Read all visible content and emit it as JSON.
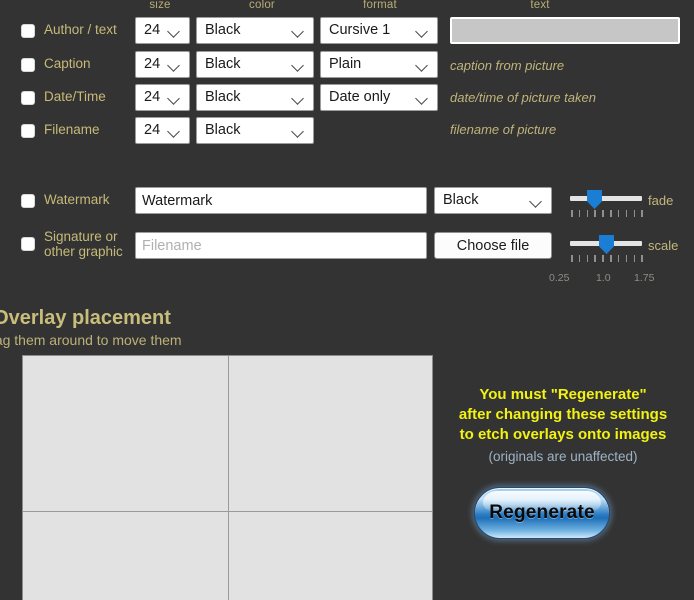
{
  "columns": {
    "size": "size",
    "color": "color",
    "format": "format",
    "text": "text"
  },
  "text_rows": [
    {
      "label": "Author / text",
      "checked": false,
      "size": "24",
      "color": "Black",
      "format": "Cursive 1",
      "text_value": "",
      "text_placeholder": "",
      "hint": ""
    },
    {
      "label": "Caption",
      "checked": false,
      "size": "24",
      "color": "Black",
      "format": "Plain",
      "hint": "caption from picture"
    },
    {
      "label": "Date/Time",
      "checked": false,
      "size": "24",
      "color": "Black",
      "format": "Date only",
      "hint": "date/time of picture taken"
    },
    {
      "label": "Filename",
      "checked": false,
      "size": "24",
      "color": "Black",
      "format": "",
      "hint": "filename of picture"
    }
  ],
  "watermark": {
    "label": "Watermark",
    "checked": false,
    "value": "Watermark",
    "color": "Black",
    "slider_name": "fade",
    "slider_percent": 30
  },
  "signature": {
    "label_line1": "Signature or",
    "label_line2": "other graphic",
    "checked": false,
    "placeholder": "Filename",
    "value": "",
    "button_label": "Choose file",
    "slider_name": "scale",
    "slider_percent": 50,
    "scale_min": "0.25",
    "scale_mid": "1.0",
    "scale_max": "1.75"
  },
  "overlay": {
    "title": "Overlay placement",
    "subtitle": "drag them around to move them"
  },
  "notice": {
    "line1": "You must \"Regenerate\"",
    "line2": "after changing these settings",
    "line3": "to etch overlays onto images",
    "line4": "(originals are unaffected)"
  },
  "regenerate": {
    "label": "Regenerate"
  },
  "colors": {
    "background": "#333333",
    "label": "#c6ba78",
    "hint": "#c0b47a",
    "warning": "#f2f213",
    "notice_sub": "#9fb3c4",
    "slider": "#1a7fd4",
    "grid": "#e2e2e2"
  }
}
